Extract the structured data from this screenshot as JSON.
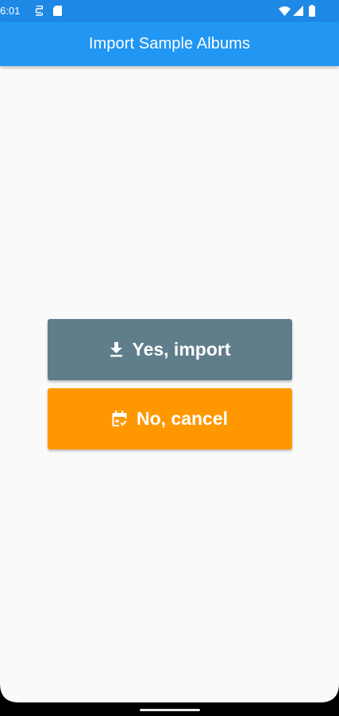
{
  "status_bar": {
    "time": "6:01",
    "icons": [
      "sim-card-icon",
      "sd-card-icon",
      "wifi-icon",
      "cell-signal-icon",
      "battery-icon"
    ]
  },
  "app_bar": {
    "title": "Import Sample Albums",
    "color": "#2196f3"
  },
  "actions": {
    "yes": {
      "label": "Yes, import",
      "icon": "download-icon",
      "color": "#607d8b"
    },
    "no": {
      "label": "No, cancel",
      "icon": "calendar-cancel-icon",
      "color": "#ff9800"
    }
  },
  "nav_bar": {
    "handle": "home-gesture-handle"
  }
}
